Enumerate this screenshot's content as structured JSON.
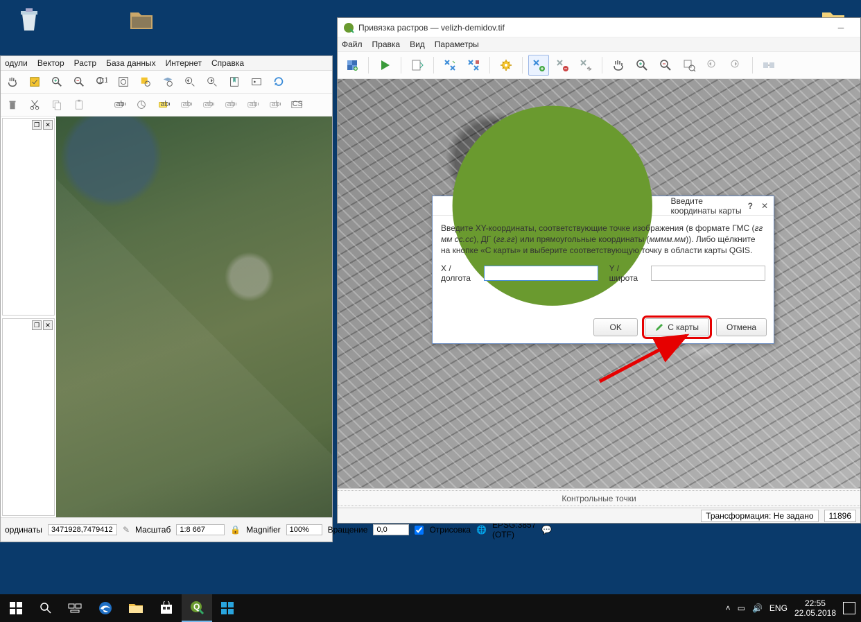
{
  "desktop": {
    "recycle_bin": "",
    "folder1": "",
    "folder2": ""
  },
  "qgis": {
    "menu": [
      "одули",
      "Вектор",
      "Растр",
      "База данных",
      "Интернет",
      "Справка"
    ],
    "status": {
      "coord_label": "ординаты",
      "coord_value": "3471928,7479412",
      "scale_label": "Масштаб",
      "scale_value": "1:8 667",
      "magnifier_label": "Magnifier",
      "magnifier_value": "100%",
      "rotation_label": "Вращение",
      "rotation_value": "0,0",
      "render_label": "Отрисовка",
      "crs_label": "EPSG:3857 (OTF)"
    }
  },
  "georef": {
    "title": "Привязка растров — velizh-demidov.tif",
    "menu": [
      "Файл",
      "Правка",
      "Вид",
      "Параметры"
    ],
    "gcp_panel": "Контрольные точки",
    "status": {
      "transform": "Трансформация: Не задано",
      "value": "11896"
    }
  },
  "dialog": {
    "title": "Введите координаты карты",
    "body_1": "Введите XY-координаты, соответствующие точке изображения (в формате ГМС (",
    "body_fmt1": "гг мм сс.сс",
    "body_2": "), ДГ (",
    "body_fmt2": "гг.гг",
    "body_3": ") или прямоугольные координаты (",
    "body_fmt3": "мммм.мм",
    "body_4": ")). Либо щёлкните на кнопке «С карты» и выберите соответствующую точку в области карты QGIS.",
    "x_label": "X / долгота",
    "y_label": "Y / широта",
    "ok": "OK",
    "from_map": "С карты",
    "cancel": "Отмена"
  },
  "taskbar": {
    "lang": "ENG",
    "time": "22:55",
    "date": "22.05.2018"
  }
}
